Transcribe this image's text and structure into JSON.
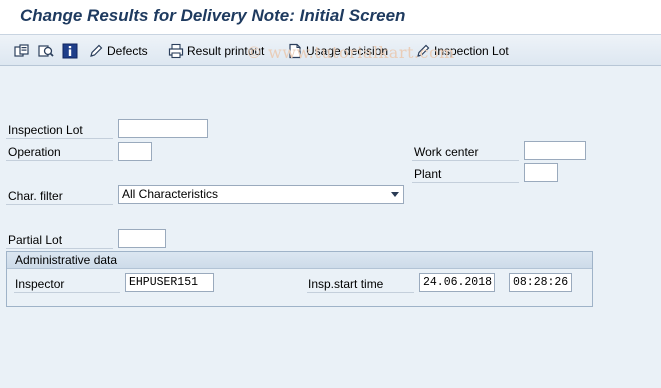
{
  "window": {
    "title": "Change Results for Delivery Note: Initial Screen"
  },
  "toolbar": {
    "items": [
      {
        "icon": "copy-icon",
        "label": ""
      },
      {
        "icon": "display-icon",
        "label": ""
      },
      {
        "icon": "info-icon",
        "label": ""
      },
      {
        "icon": "pencil-icon",
        "label": "Defects"
      },
      {
        "icon": "printer-icon",
        "label": "Result printout"
      },
      {
        "icon": "document-icon",
        "label": "Usage decision"
      },
      {
        "icon": "pencil-icon",
        "label": "Inspection Lot"
      }
    ]
  },
  "watermark": "© www.tutorialkart.com",
  "form": {
    "inspection_lot": {
      "label": "Inspection Lot",
      "value": ""
    },
    "operation": {
      "label": "Operation",
      "value": ""
    },
    "work_center": {
      "label": "Work center",
      "value": ""
    },
    "plant": {
      "label": "Plant",
      "value": ""
    },
    "char_filter": {
      "label": "Char. filter",
      "value": "All Characteristics"
    },
    "partial_lot": {
      "label": "Partial Lot",
      "value": ""
    }
  },
  "admin": {
    "title": "Administrative data",
    "inspector": {
      "label": "Inspector",
      "value": "EHPUSER151"
    },
    "insp_start": {
      "label": "Insp.start time",
      "date": "24.06.2018",
      "time": "08:28:26"
    }
  },
  "colors": {
    "title": "#1e3a5f",
    "background": "#eaf1f7",
    "toolbar": "#dde7f1"
  }
}
